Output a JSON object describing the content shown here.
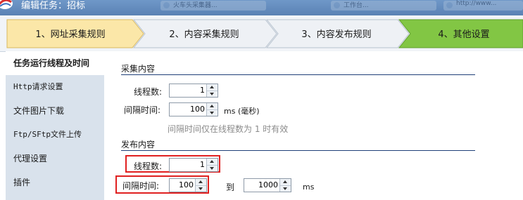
{
  "window": {
    "title": "编辑任务：招标",
    "background_tabs": [
      "火车头采集器...",
      "工作台...",
      "http://www..."
    ]
  },
  "steps": [
    {
      "label": "1、网址采集规则",
      "state": "normal"
    },
    {
      "label": "2、内容采集规则",
      "state": "normal"
    },
    {
      "label": "3、内容发布规则",
      "state": "normal"
    },
    {
      "label": "4、其他设置",
      "state": "active"
    }
  ],
  "colors": {
    "step1_fill": "#fbe7a8",
    "step_fill": "#eef1f5",
    "step_active_fill": "#82c644",
    "section_line": "#1f3f78",
    "highlight_box": "#e02020"
  },
  "sidenav": {
    "items": [
      {
        "label": "任务运行线程及时间",
        "active": true
      },
      {
        "label": "Http请求设置",
        "active": false
      },
      {
        "label": "文件图片下载",
        "active": false
      },
      {
        "label": "Ftp/SFtp文件上传",
        "active": false
      },
      {
        "label": "代理设置",
        "active": false
      },
      {
        "label": "插件",
        "active": false
      }
    ]
  },
  "collect": {
    "title": "采集内容",
    "threads_label": "线程数:",
    "threads_value": "1",
    "interval_label": "间隔时间:",
    "interval_value": "100",
    "interval_unit": "ms (毫秒)",
    "hint": "间隔时间仅在线程数为 1 时有效"
  },
  "publish": {
    "title": "发布内容",
    "threads_label": "线程数:",
    "threads_value": "1",
    "interval_label": "间隔时间:",
    "interval_from_value": "100",
    "to_label": "到",
    "interval_to_value": "1000",
    "interval_unit": "ms"
  }
}
